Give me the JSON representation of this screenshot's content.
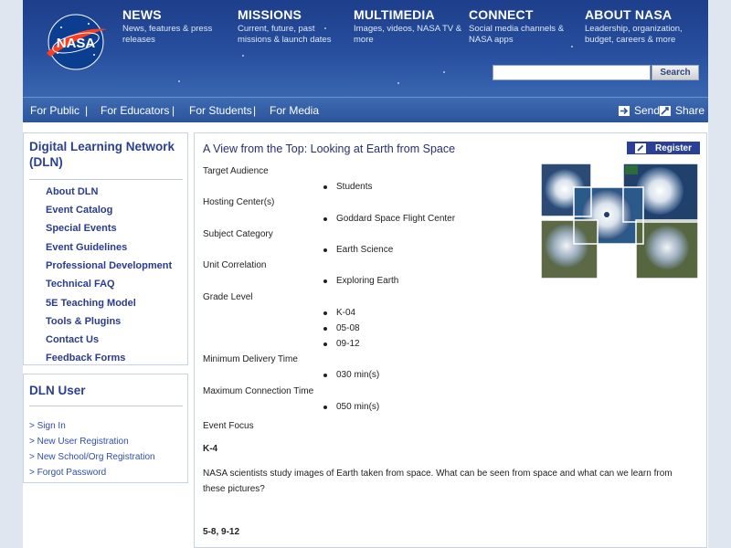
{
  "header": {
    "nav": [
      {
        "title": "NEWS",
        "sub": "News, features & press releases"
      },
      {
        "title": "MISSIONS",
        "sub": "Current, future, past missions & launch dates"
      },
      {
        "title": "MULTIMEDIA",
        "sub": "Images, videos, NASA TV & more"
      },
      {
        "title": "CONNECT",
        "sub": "Social media channels & NASA apps"
      },
      {
        "title": "ABOUT NASA",
        "sub": "Leadership, organization, budget, careers & more"
      }
    ],
    "logo_text": "NASA",
    "search": {
      "placeholder": "",
      "button": "Search"
    }
  },
  "audience": {
    "links": [
      "For Public",
      "For Educators",
      "For Students",
      "For Media"
    ],
    "separator": "|",
    "send": "Send",
    "share": "Share"
  },
  "sidebar": {
    "title": "Digital Learning Network (DLN)",
    "links": [
      "About DLN",
      "Event Catalog",
      "Special Events",
      "Event Guidelines",
      "Professional Development",
      "Technical FAQ",
      "5E Teaching Model",
      "Tools & Plugins",
      "Contact Us",
      "Feedback Forms"
    ],
    "user_title": "DLN User",
    "user_links": [
      "> Sign In",
      "> New User Registration",
      "> New School/Org Registration",
      "> Forgot Password"
    ]
  },
  "event": {
    "title": "A View from the Top: Looking at Earth from Space",
    "register": "Register",
    "fields": {
      "target_audience": {
        "label": "Target Audience",
        "values": [
          "Students"
        ]
      },
      "hosting_center": {
        "label": "Hosting Center(s)",
        "values": [
          "Goddard Space Flight Center"
        ]
      },
      "subject_category": {
        "label": "Subject Category",
        "values": [
          "Earth Science"
        ]
      },
      "unit_correlation": {
        "label": "Unit Correlation",
        "values": [
          "Exploring Earth"
        ]
      },
      "grade_level": {
        "label": "Grade Level",
        "values": [
          "K-04",
          "05-08",
          "09-12"
        ]
      },
      "min_delivery": {
        "label": "Minimum Delivery Time",
        "values": [
          "030 min(s)"
        ]
      },
      "max_connection": {
        "label": "Maximum Connection Time",
        "values": [
          "050 min(s)"
        ]
      }
    },
    "focus_label": "Event Focus",
    "focus_k4_head": "K-4",
    "focus_k4_text": "NASA scientists study images of Earth taken from space. What can be seen from space and what can we learn from these pictures?",
    "focus_58_head": "5-8, 9-12"
  },
  "colors": {
    "header_blue": "#274f9e",
    "link_blue": "#2a3c8c",
    "register_bg": "#2a3f96"
  }
}
